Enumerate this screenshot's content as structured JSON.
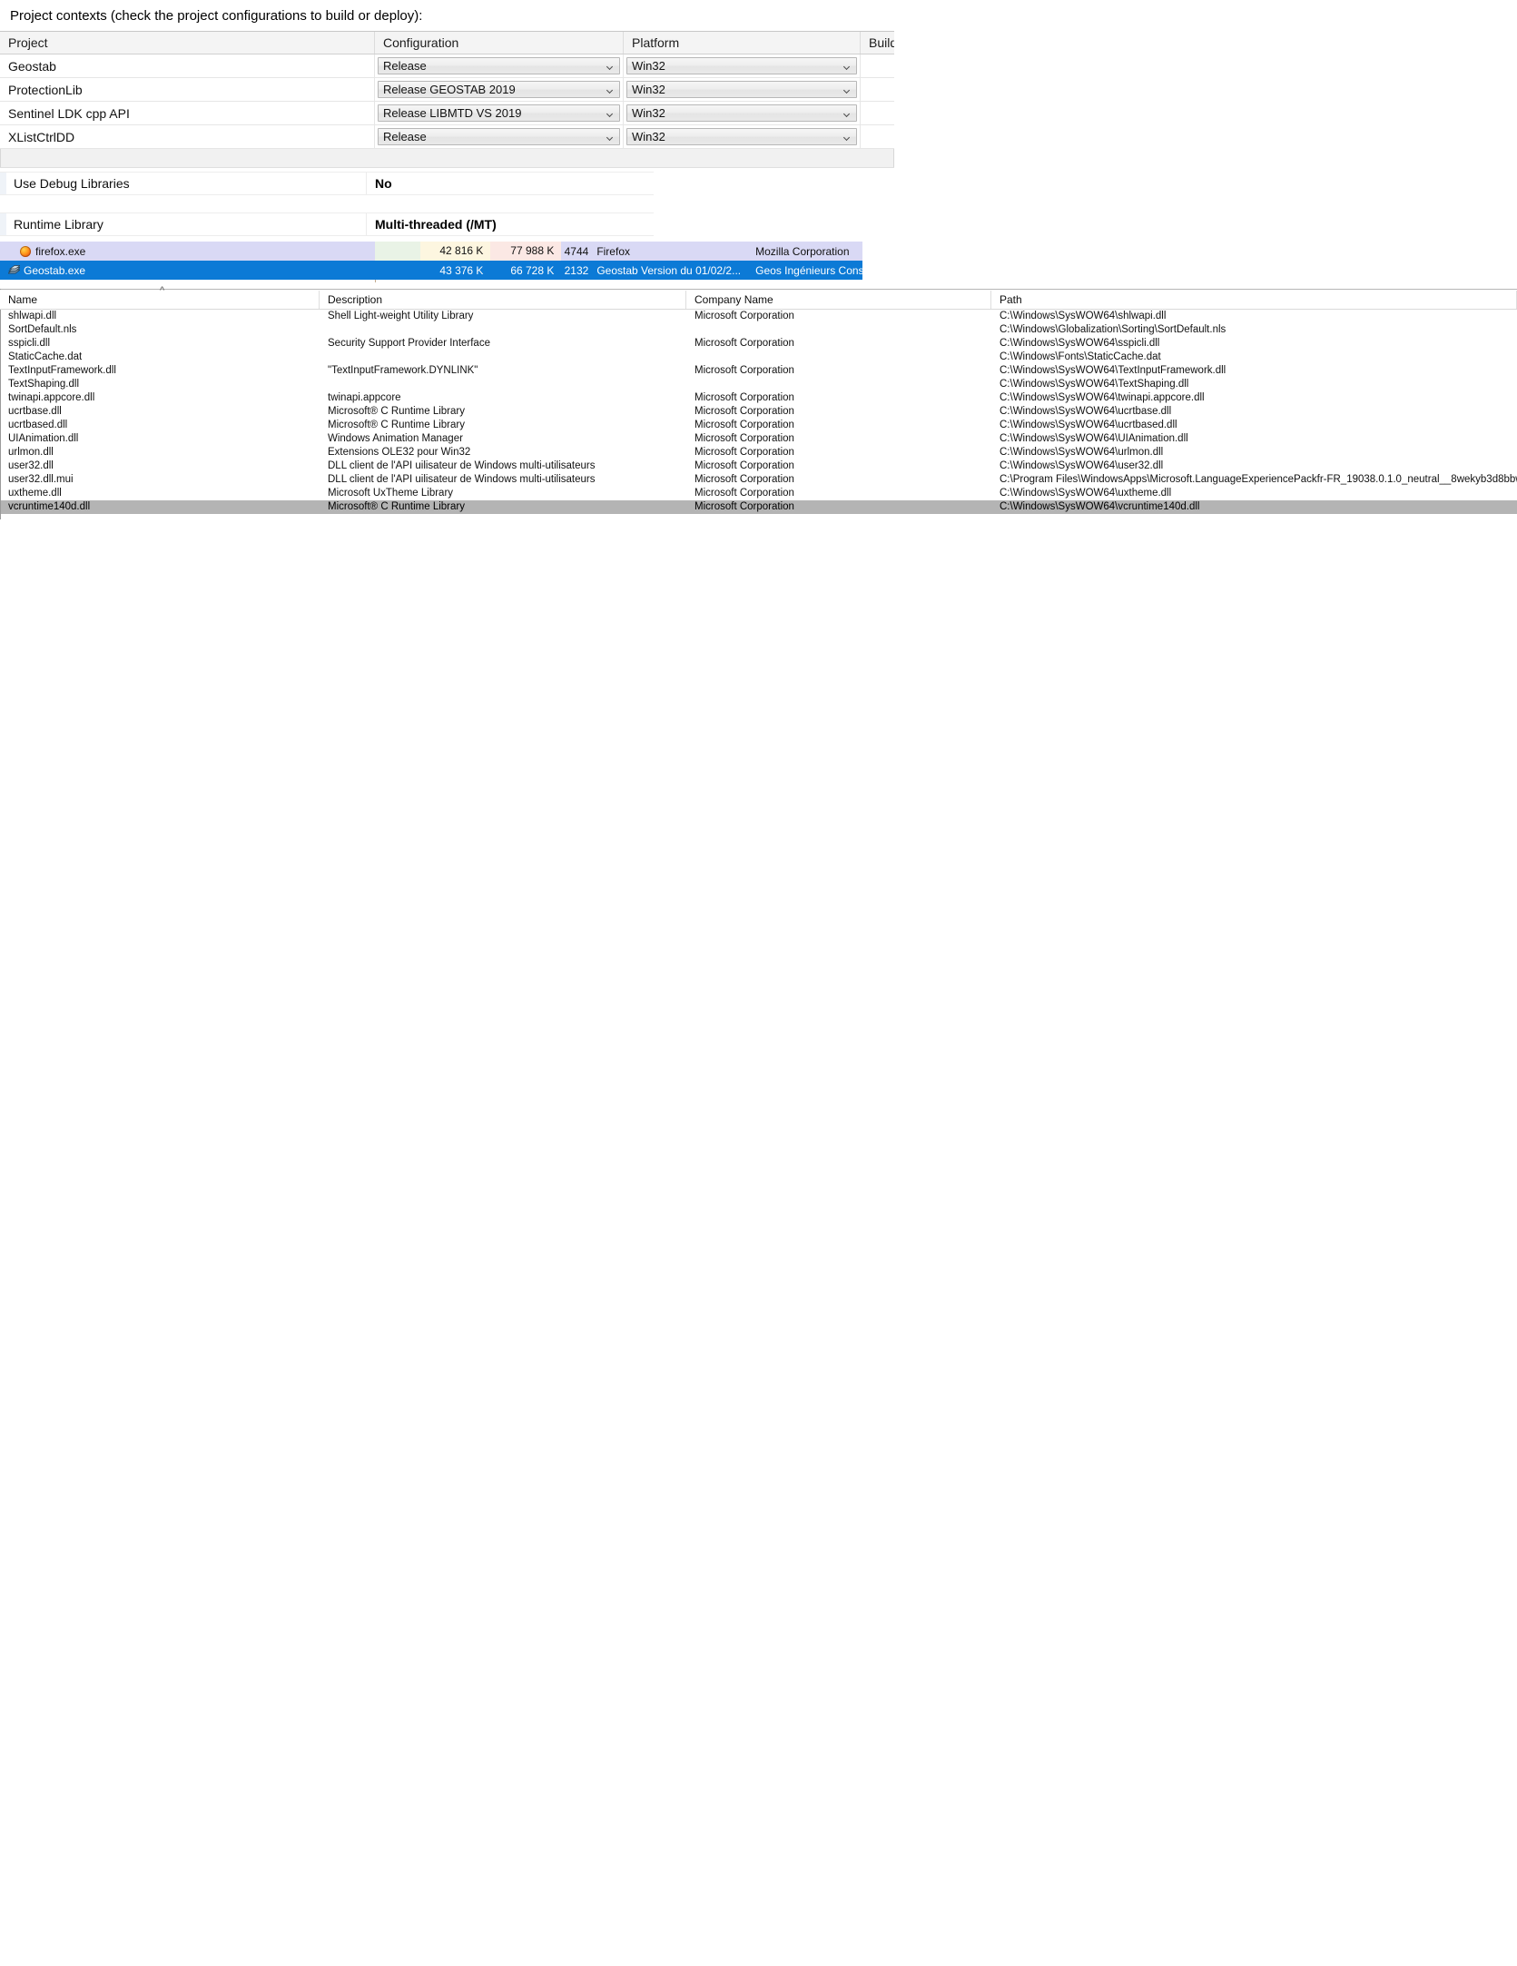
{
  "project_contexts": {
    "caption": "Project contexts (check the project configurations to build or deploy):",
    "columns": [
      "Project",
      "Configuration",
      "Platform",
      "Build"
    ],
    "rows": [
      {
        "project": "Geostab",
        "configuration": "Release",
        "platform": "Win32",
        "build": ""
      },
      {
        "project": "ProtectionLib",
        "configuration": "Release GEOSTAB 2019",
        "platform": "Win32",
        "build": ""
      },
      {
        "project": "Sentinel LDK cpp API",
        "configuration": "Release LIBMTD VS 2019",
        "platform": "Win32",
        "build": ""
      },
      {
        "project": "XListCtrlDD",
        "configuration": "Release",
        "platform": "Win32",
        "build": ""
      }
    ]
  },
  "properties": [
    {
      "name": "Use Debug Libraries",
      "value": "No"
    },
    {
      "name": "Runtime Library",
      "value": "Multi-threaded (/MT)"
    }
  ],
  "processes": {
    "rows": [
      {
        "icon": "firefox-icon",
        "name": "firefox.exe",
        "cpu": "",
        "private_bytes": "42 816 K",
        "working_set": "77 988 K",
        "pid": "4744",
        "description": "Firefox",
        "company": "Mozilla Corporation"
      },
      {
        "icon": "geostab-icon",
        "name": "Geostab.exe",
        "cpu": "",
        "private_bytes": "43 376 K",
        "working_set": "66 728 K",
        "pid": "2132",
        "description": "Geostab Version du 01/02/2...",
        "company": "Geos Ingénieurs Conseils"
      }
    ]
  },
  "dll_list": {
    "columns": [
      "Name",
      "Description",
      "Company Name",
      "Path"
    ],
    "sort_indicator": "^",
    "rows": [
      {
        "name": "shlwapi.dll",
        "description": "Shell Light-weight Utility Library",
        "company": "Microsoft Corporation",
        "path": "C:\\Windows\\SysWOW64\\shlwapi.dll"
      },
      {
        "name": "SortDefault.nls",
        "description": "",
        "company": "",
        "path": "C:\\Windows\\Globalization\\Sorting\\SortDefault.nls"
      },
      {
        "name": "sspicli.dll",
        "description": "Security Support Provider Interface",
        "company": "Microsoft Corporation",
        "path": "C:\\Windows\\SysWOW64\\sspicli.dll"
      },
      {
        "name": "StaticCache.dat",
        "description": "",
        "company": "",
        "path": "C:\\Windows\\Fonts\\StaticCache.dat"
      },
      {
        "name": "TextInputFramework.dll",
        "description": "\"TextInputFramework.DYNLINK\"",
        "company": "Microsoft Corporation",
        "path": "C:\\Windows\\SysWOW64\\TextInputFramework.dll"
      },
      {
        "name": "TextShaping.dll",
        "description": "",
        "company": "",
        "path": "C:\\Windows\\SysWOW64\\TextShaping.dll"
      },
      {
        "name": "twinapi.appcore.dll",
        "description": "twinapi.appcore",
        "company": "Microsoft Corporation",
        "path": "C:\\Windows\\SysWOW64\\twinapi.appcore.dll"
      },
      {
        "name": "ucrtbase.dll",
        "description": "Microsoft® C Runtime Library",
        "company": "Microsoft Corporation",
        "path": "C:\\Windows\\SysWOW64\\ucrtbase.dll"
      },
      {
        "name": "ucrtbased.dll",
        "description": "Microsoft® C Runtime Library",
        "company": "Microsoft Corporation",
        "path": "C:\\Windows\\SysWOW64\\ucrtbased.dll"
      },
      {
        "name": "UIAnimation.dll",
        "description": "Windows Animation Manager",
        "company": "Microsoft Corporation",
        "path": "C:\\Windows\\SysWOW64\\UIAnimation.dll"
      },
      {
        "name": "urlmon.dll",
        "description": "Extensions OLE32 pour Win32",
        "company": "Microsoft Corporation",
        "path": "C:\\Windows\\SysWOW64\\urlmon.dll"
      },
      {
        "name": "user32.dll",
        "description": "DLL client de l'API uilisateur de Windows multi-utilisateurs",
        "company": "Microsoft Corporation",
        "path": "C:\\Windows\\SysWOW64\\user32.dll"
      },
      {
        "name": "user32.dll.mui",
        "description": "DLL client de l'API uilisateur de Windows multi-utilisateurs",
        "company": "Microsoft Corporation",
        "path": "C:\\Program Files\\WindowsApps\\Microsoft.LanguageExperiencePackfr-FR_19038.0.1.0_neutral__8wekyb3d8bbwe\\Wind"
      },
      {
        "name": "uxtheme.dll",
        "description": "Microsoft UxTheme Library",
        "company": "Microsoft Corporation",
        "path": "C:\\Windows\\SysWOW64\\uxtheme.dll"
      },
      {
        "name": "vcruntime140d.dll",
        "description": "Microsoft® C Runtime Library",
        "company": "Microsoft Corporation",
        "path": "C:\\Windows\\SysWOW64\\vcruntime140d.dll",
        "selected": true
      }
    ]
  },
  "colors": {
    "selection_blue": "#0c7ad6",
    "selection_grey": "#b4b4b4",
    "firefox_row": "#d9d9f5"
  }
}
